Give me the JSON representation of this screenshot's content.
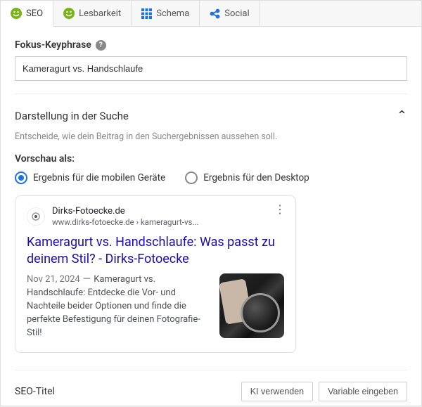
{
  "tabs": {
    "seo": {
      "label": "SEO"
    },
    "read": {
      "label": "Lesbarkeit"
    },
    "schema": {
      "label": "Schema"
    },
    "social": {
      "label": "Social"
    }
  },
  "keyphrase": {
    "label": "Fokus-Keyphrase",
    "value": "Kameragurt vs. Handschlaufe"
  },
  "search_appearance": {
    "title": "Darstellung in der Suche",
    "description": "Entscheide, wie dein Beitrag in den Suchergebnissen aussehen soll.",
    "preview_as_label": "Vorschau als:",
    "option_mobile": "Ergebnis für die mobilen Geräte",
    "option_desktop": "Ergebnis für den Desktop"
  },
  "serp": {
    "site_name": "Dirks-Fotoecke.de",
    "breadcrumb": "www.dirks-fotoecke.de › kameragurt-vs...",
    "title": "Kameragurt vs. Handschlaufe: Was passt zu deinem Stil? - Dirks-Fotoecke",
    "date": "Nov 21, 2024",
    "separator": " － ",
    "description": "Kameragurt vs. Handschlaufe: Entdecke die Vor- und Nachteile beider Optionen und finde die perfekte Befestigung für deinen Fotografie-Stil!"
  },
  "seo_title": {
    "label": "SEO-Titel",
    "btn_ai": "KI verwenden",
    "btn_var": "Variable eingeben"
  },
  "colors": {
    "good": "#7ab317",
    "link": "#1a73e8"
  }
}
